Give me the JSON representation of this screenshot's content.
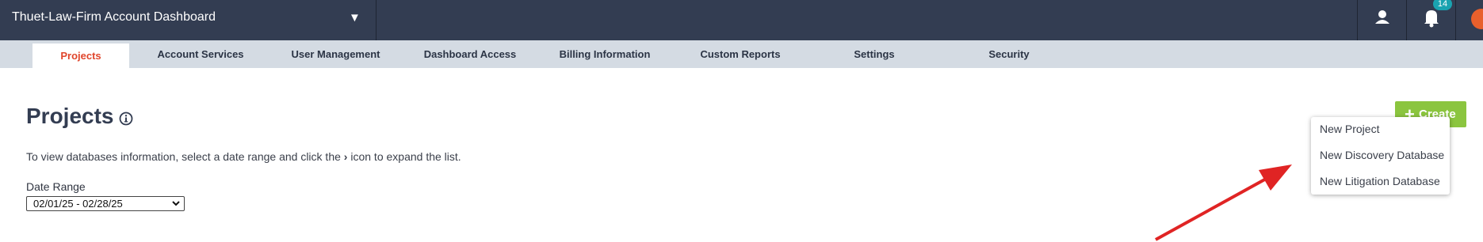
{
  "header": {
    "account_title": "Thuet-Law-Firm Account Dashboard",
    "notification_count": "14",
    "icons": [
      "chevron-down-icon",
      "user-icon",
      "bell-icon",
      "avatar"
    ]
  },
  "nav": {
    "tabs": [
      {
        "label": "Projects",
        "active": true
      },
      {
        "label": "Account Services"
      },
      {
        "label": "User Management"
      },
      {
        "label": "Dashboard Access"
      },
      {
        "label": "Billing Information"
      },
      {
        "label": "Custom Reports"
      },
      {
        "label": "Settings"
      },
      {
        "label": "Security"
      }
    ]
  },
  "main": {
    "title": "Projects",
    "description_before": "To view databases information, select a date range and click the",
    "description_after": "icon to expand the list.",
    "date_range": {
      "label": "Date Range",
      "selected": "02/01/25 - 02/28/25"
    },
    "create_button": "Create",
    "create_menu": [
      "New Project",
      "New Discovery Database",
      "New Litigation Database"
    ]
  },
  "colors": {
    "topbar": "#333d52",
    "nav_bar": "#d4dbe3",
    "active_tab_text": "#e0452b",
    "create_button": "#8bc53f",
    "badge": "#1aa3b0",
    "annotation_arrow": "#e02424"
  }
}
